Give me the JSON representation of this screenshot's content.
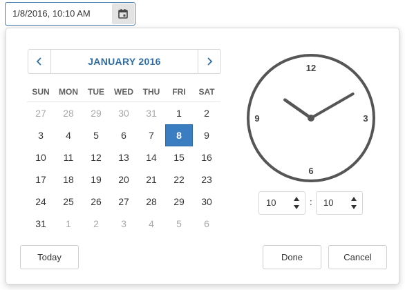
{
  "input": {
    "value": "1/8/2016, 10:10 AM",
    "button_icon": "calendar-icon"
  },
  "calendar": {
    "month_title": "JANUARY 2016",
    "prev_icon": "chevron-left-icon",
    "next_icon": "chevron-right-icon",
    "weekdays": [
      "SUN",
      "MON",
      "TUE",
      "WED",
      "THU",
      "FRI",
      "SAT"
    ],
    "weeks": [
      [
        "27",
        "28",
        "29",
        "30",
        "31",
        "1",
        "2"
      ],
      [
        "3",
        "4",
        "5",
        "6",
        "7",
        "8",
        "9"
      ],
      [
        "10",
        "11",
        "12",
        "13",
        "14",
        "15",
        "16"
      ],
      [
        "17",
        "18",
        "19",
        "20",
        "21",
        "22",
        "23"
      ],
      [
        "24",
        "25",
        "26",
        "27",
        "28",
        "29",
        "30"
      ],
      [
        "31",
        "1",
        "2",
        "3",
        "4",
        "5",
        "6"
      ]
    ],
    "selected_day": "8"
  },
  "clock": {
    "labels": {
      "twelve": "12",
      "three": "3",
      "six": "6",
      "nine": "9"
    },
    "hour": 10,
    "minute": 10
  },
  "time": {
    "hour_value": "10",
    "minute_value": "10",
    "separator": ":"
  },
  "buttons": {
    "today": "Today",
    "done": "Done",
    "cancel": "Cancel"
  },
  "colors": {
    "accent": "#3a7dc0",
    "title": "#2f6da6",
    "clock_stroke": "#555555"
  }
}
